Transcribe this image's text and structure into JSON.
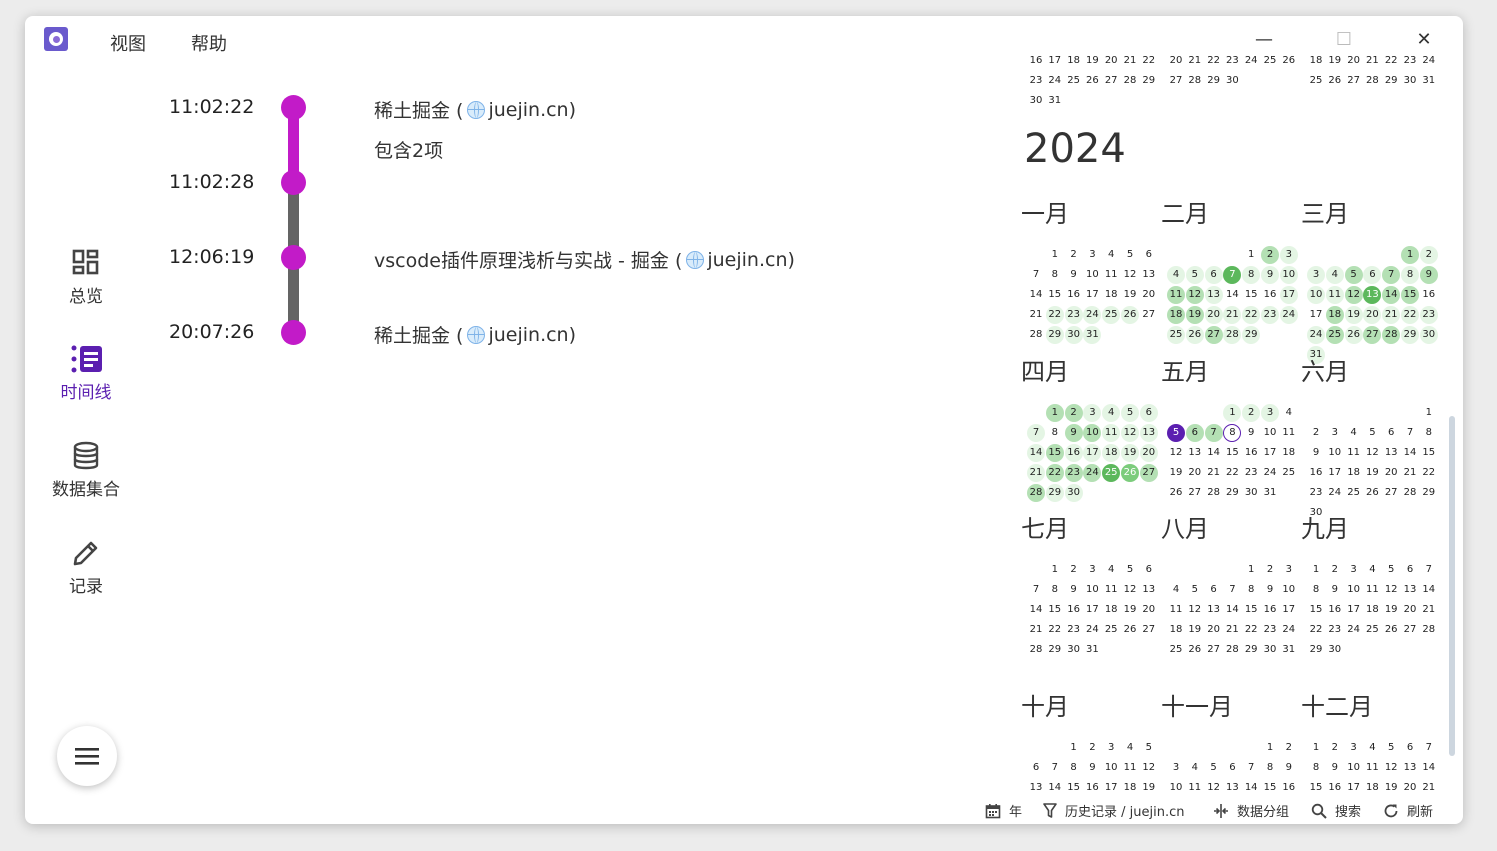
{
  "menu": {
    "view": "视图",
    "help": "帮助"
  },
  "window_controls": {
    "minimize": "—",
    "maximize": "☐",
    "close": "✕"
  },
  "nav": {
    "overview": "总览",
    "timeline": "时间线",
    "datasets": "数据集合",
    "record": "记录"
  },
  "timeline": {
    "entries": [
      {
        "time": "11:02:22",
        "title": "稀土掘金 (",
        "domain": "juejin.cn)",
        "sub": "包含2项"
      },
      {
        "time": "11:02:28"
      },
      {
        "time": "12:06:19",
        "title": "vscode插件原理浅析与实战 - 掘金 (",
        "domain": "juejin.cn)"
      },
      {
        "time": "20:07:26",
        "title": "稀土掘金 (",
        "domain": "juejin.cn)"
      }
    ]
  },
  "calendar": {
    "year": "2024",
    "prev_rows": [
      [
        "16",
        "17",
        "18",
        "19",
        "20",
        "21",
        "22"
      ],
      [
        "23",
        "24",
        "25",
        "26",
        "27",
        "28",
        "29"
      ],
      [
        "30",
        "31"
      ],
      [
        "20",
        "21",
        "22",
        "23",
        "24",
        "25",
        "26"
      ],
      [
        "27",
        "28",
        "29",
        "30"
      ],
      [
        "18",
        "19",
        "20",
        "21",
        "22",
        "23",
        "24"
      ],
      [
        "25",
        "26",
        "27",
        "28",
        "29",
        "30",
        "31"
      ]
    ],
    "months": [
      "一月",
      "二月",
      "三月",
      "四月",
      "五月",
      "六月",
      "七月",
      "八月",
      "九月",
      "十月",
      "十一月",
      "十二月"
    ],
    "activity": {
      "1": {
        "22": 1,
        "23": 1,
        "24": 1,
        "25": 1,
        "26": 1,
        "29": 1,
        "30": 1,
        "31": 1
      },
      "2": {
        "2": 2,
        "3": 1,
        "4": 1,
        "5": 1,
        "6": 1,
        "7": 4,
        "8": 1,
        "9": 1,
        "10": 1,
        "11": 2,
        "12": 2,
        "13": 1,
        "17": 1,
        "18": 2,
        "19": 2,
        "20": 1,
        "21": 1,
        "22": 1,
        "23": 1,
        "24": 1,
        "25": 1,
        "26": 1,
        "27": 2,
        "28": 1,
        "29": 1
      },
      "3": {
        "1": 2,
        "2": 1,
        "3": 1,
        "4": 1,
        "5": 2,
        "6": 1,
        "7": 2,
        "8": 1,
        "9": 2,
        "10": 1,
        "11": 1,
        "12": 2,
        "13": 4,
        "14": 2,
        "15": 2,
        "18": 2,
        "19": 1,
        "20": 1,
        "21": 1,
        "22": 1,
        "23": 1,
        "24": 1,
        "25": 2,
        "26": 1,
        "27": 2,
        "28": 2,
        "29": 1,
        "30": 1,
        "31": 1
      },
      "4": {
        "1": 2,
        "2": 2,
        "3": 1,
        "4": 1,
        "5": 1,
        "6": 1,
        "7": 1,
        "9": 2,
        "10": 2,
        "11": 1,
        "12": 1,
        "13": 1,
        "14": 1,
        "15": 2,
        "16": 1,
        "17": 1,
        "18": 1,
        "19": 1,
        "20": 1,
        "21": 1,
        "22": 2,
        "23": 2,
        "24": 2,
        "25": 4,
        "26": 3,
        "27": 2,
        "28": 2,
        "29": 1,
        "30": 1
      },
      "5": {
        "1": 1,
        "2": 1,
        "3": 1,
        "6": 2,
        "7": 2
      },
      "6": {}
    },
    "selected": {
      "month": 5,
      "day": 5
    },
    "today": {
      "month": 5,
      "day": 8
    },
    "colors": {
      "l1": "#e4f5e4",
      "l2": "#b4e0b4",
      "l3": "#7ccc7c",
      "l4": "#5cb85c",
      "selected": "#5b1fb0",
      "accent": "#c21bc8"
    }
  },
  "statusbar": {
    "year": "年",
    "history": "历史记录 / juejin.cn",
    "group": "数据分组",
    "search": "搜索",
    "refresh": "刷新"
  }
}
